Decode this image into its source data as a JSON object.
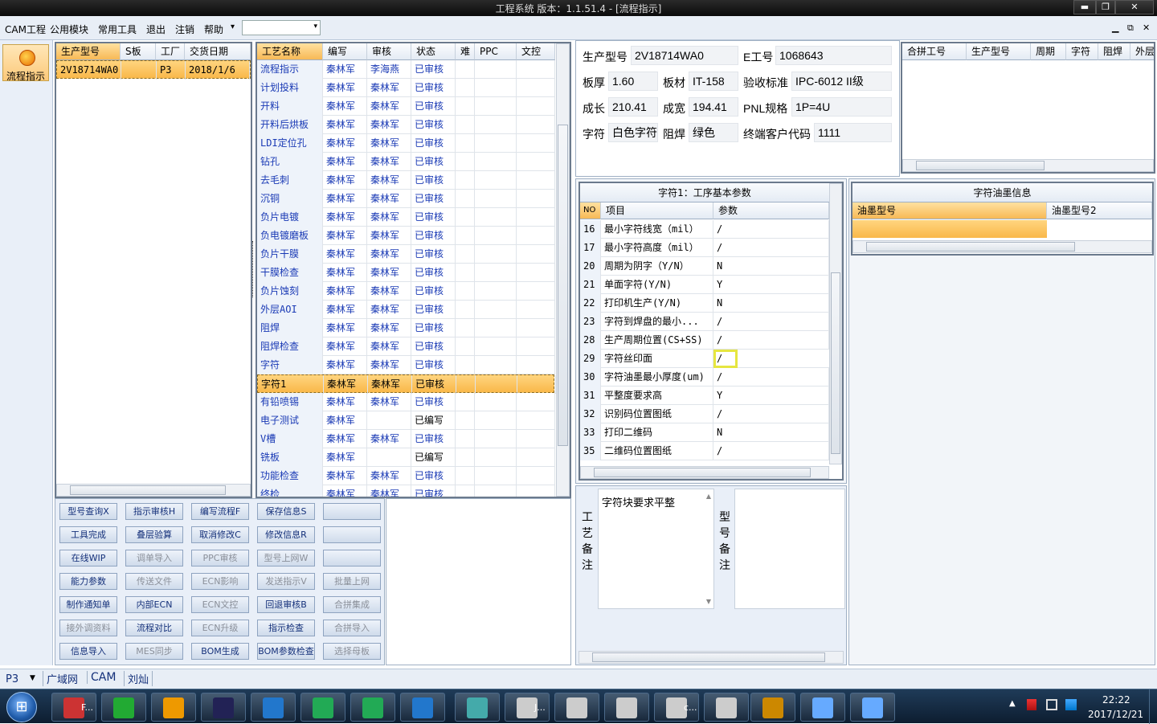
{
  "window": {
    "title": "工程系统   版本：1.1.51.4 - [流程指示]",
    "min": "▬",
    "restore": "❐",
    "close": "✕"
  },
  "menu": {
    "items": [
      "CAM工程",
      "公用模块",
      "常用工具",
      "退出",
      "注销",
      "帮助"
    ],
    "help_arrow": "▾",
    "combo_value": "",
    "mdi_min": "▁",
    "mdi_restore": "⧉",
    "mdi_close": "✕"
  },
  "nav": {
    "flow_label": "流程指示"
  },
  "orders": {
    "headers": [
      "生产型号",
      "S板",
      "工厂",
      "交货日期"
    ],
    "rows": [
      [
        "2V18714WA0",
        "",
        "P3",
        "2018/1/6"
      ]
    ]
  },
  "process": {
    "headers": [
      "工艺名称",
      "编写",
      "审核",
      "状态",
      "难",
      "PPC",
      "文控"
    ],
    "rows": [
      [
        "流程指示",
        "秦林军",
        "李海燕",
        "已审核"
      ],
      [
        "计划投料",
        "秦林军",
        "秦林军",
        "已审核"
      ],
      [
        "开料",
        "秦林军",
        "秦林军",
        "已审核"
      ],
      [
        "开料后烘板",
        "秦林军",
        "秦林军",
        "已审核"
      ],
      [
        "LDI定位孔",
        "秦林军",
        "秦林军",
        "已审核"
      ],
      [
        "钻孔",
        "秦林军",
        "秦林军",
        "已审核"
      ],
      [
        "去毛刺",
        "秦林军",
        "秦林军",
        "已审核"
      ],
      [
        "沉铜",
        "秦林军",
        "秦林军",
        "已审核"
      ],
      [
        "负片电镀",
        "秦林军",
        "秦林军",
        "已审核"
      ],
      [
        "负电镀磨板",
        "秦林军",
        "秦林军",
        "已审核"
      ],
      [
        "负片干膜",
        "秦林军",
        "秦林军",
        "已审核"
      ],
      [
        "干膜检查",
        "秦林军",
        "秦林军",
        "已审核"
      ],
      [
        "负片蚀刻",
        "秦林军",
        "秦林军",
        "已审核"
      ],
      [
        "外层AOI",
        "秦林军",
        "秦林军",
        "已审核"
      ],
      [
        "阻焊",
        "秦林军",
        "秦林军",
        "已审核"
      ],
      [
        "阻焊检查",
        "秦林军",
        "秦林军",
        "已审核"
      ],
      [
        "字符",
        "秦林军",
        "秦林军",
        "已审核"
      ],
      [
        "字符1",
        "秦林军",
        "秦林军",
        "已审核"
      ],
      [
        "有铅喷锡",
        "秦林军",
        "秦林军",
        "已审核"
      ],
      [
        "电子测试",
        "秦林军",
        "",
        "已编写"
      ],
      [
        "V槽",
        "秦林军",
        "秦林军",
        "已审核"
      ],
      [
        "铣板",
        "秦林军",
        "",
        "已编写"
      ],
      [
        "功能检查",
        "秦林军",
        "秦林军",
        "已审核"
      ],
      [
        "终检",
        "秦林军",
        "秦林军",
        "已审核"
      ]
    ],
    "selected_index": 17
  },
  "buttons": [
    [
      "型号查询X",
      "指示审核H",
      "编写流程F",
      "保存信息S",
      ""
    ],
    [
      "工具完成",
      "叠层验算",
      "取消修改C",
      "修改信息R",
      ""
    ],
    [
      "在线WIP",
      "调单导入",
      "PPC审核",
      "型号上网W",
      ""
    ],
    [
      "能力参数",
      "传送文件",
      "ECN影响",
      "发送指示V",
      "批量上网"
    ],
    [
      "制作通知单",
      "内部ECN",
      "ECN文控",
      "回退审核B",
      "合拼集成"
    ],
    [
      "接外调资料",
      "流程对比",
      "ECN升级",
      "指示检查",
      "合拼导入"
    ],
    [
      "信息导入",
      "MES同步",
      "BOM生成",
      "BOM参数检查",
      "选择母板"
    ]
  ],
  "buttons_disabled": [
    [
      false,
      false,
      false,
      false,
      false
    ],
    [
      false,
      false,
      false,
      false,
      false
    ],
    [
      false,
      true,
      true,
      true,
      false
    ],
    [
      false,
      true,
      true,
      true,
      true
    ],
    [
      false,
      false,
      true,
      false,
      true
    ],
    [
      true,
      false,
      true,
      false,
      true
    ],
    [
      false,
      true,
      false,
      false,
      true
    ]
  ],
  "info": {
    "model_label": "生产型号",
    "model": "2V18714WA0",
    "eno_label": "E工号",
    "eno": "1068643",
    "thick_label": "板厚",
    "thick": "1.60",
    "material_label": "板材",
    "material": "IT-158",
    "standard_label": "验收标准",
    "standard": "IPC-6012 II级",
    "length_label": "成长",
    "length": "210.41",
    "width_label": "成宽",
    "width": "194.41",
    "pnl_label": "PNL规格",
    "pnl": "1P=4U",
    "char_label": "字符",
    "char": "白色字符",
    "mask_label": "阻焊",
    "mask": "绿色",
    "customer_label": "终端客户代码",
    "customer": "1111"
  },
  "merge": {
    "headers": [
      "合拼工号",
      "生产型号",
      "周期",
      "字符",
      "阻焊",
      "外层"
    ]
  },
  "params": {
    "title": "字符1：工序基本参数",
    "headers": [
      "NO",
      "项目",
      "参数"
    ],
    "rows": [
      [
        "16",
        "最小字符线宽（mil）",
        "/"
      ],
      [
        "17",
        "最小字符高度（mil）",
        "/"
      ],
      [
        "20",
        "周期为阴字（Y/N）",
        "N"
      ],
      [
        "21",
        "单面字符(Y/N)",
        "Y"
      ],
      [
        "22",
        "打印机生产(Y/N)",
        "N"
      ],
      [
        "23",
        "字符到焊盘的最小...",
        "/"
      ],
      [
        "28",
        "生产周期位置(CS+SS)",
        "/"
      ],
      [
        "29",
        "字符丝印面",
        "/"
      ],
      [
        "30",
        "字符油墨最小厚度(um)",
        "/"
      ],
      [
        "31",
        "平整度要求高",
        "Y"
      ],
      [
        "32",
        "识别码位置图纸",
        "/"
      ],
      [
        "33",
        "打印二维码",
        "N"
      ],
      [
        "35",
        "二维码位置图纸",
        "/"
      ]
    ]
  },
  "ink": {
    "title": "字符油墨信息",
    "headers": [
      "油墨型号",
      "油墨型号2"
    ]
  },
  "remarks": {
    "process_label": "工艺备注",
    "process_text": "字符块要求平整",
    "model_label": "型号备注",
    "model_text": ""
  },
  "status": {
    "factory": "P3",
    "items": [
      "广域网",
      "CAM",
      "刘灿"
    ]
  },
  "taskbar": {
    "items": [
      "F...",
      "",
      "",
      "",
      "",
      "",
      "",
      "",
      "",
      "J...",
      "",
      "",
      "c...",
      "",
      "",
      "",
      ""
    ],
    "time": "22:22",
    "date": "2017/12/21",
    "start": "⊞"
  }
}
